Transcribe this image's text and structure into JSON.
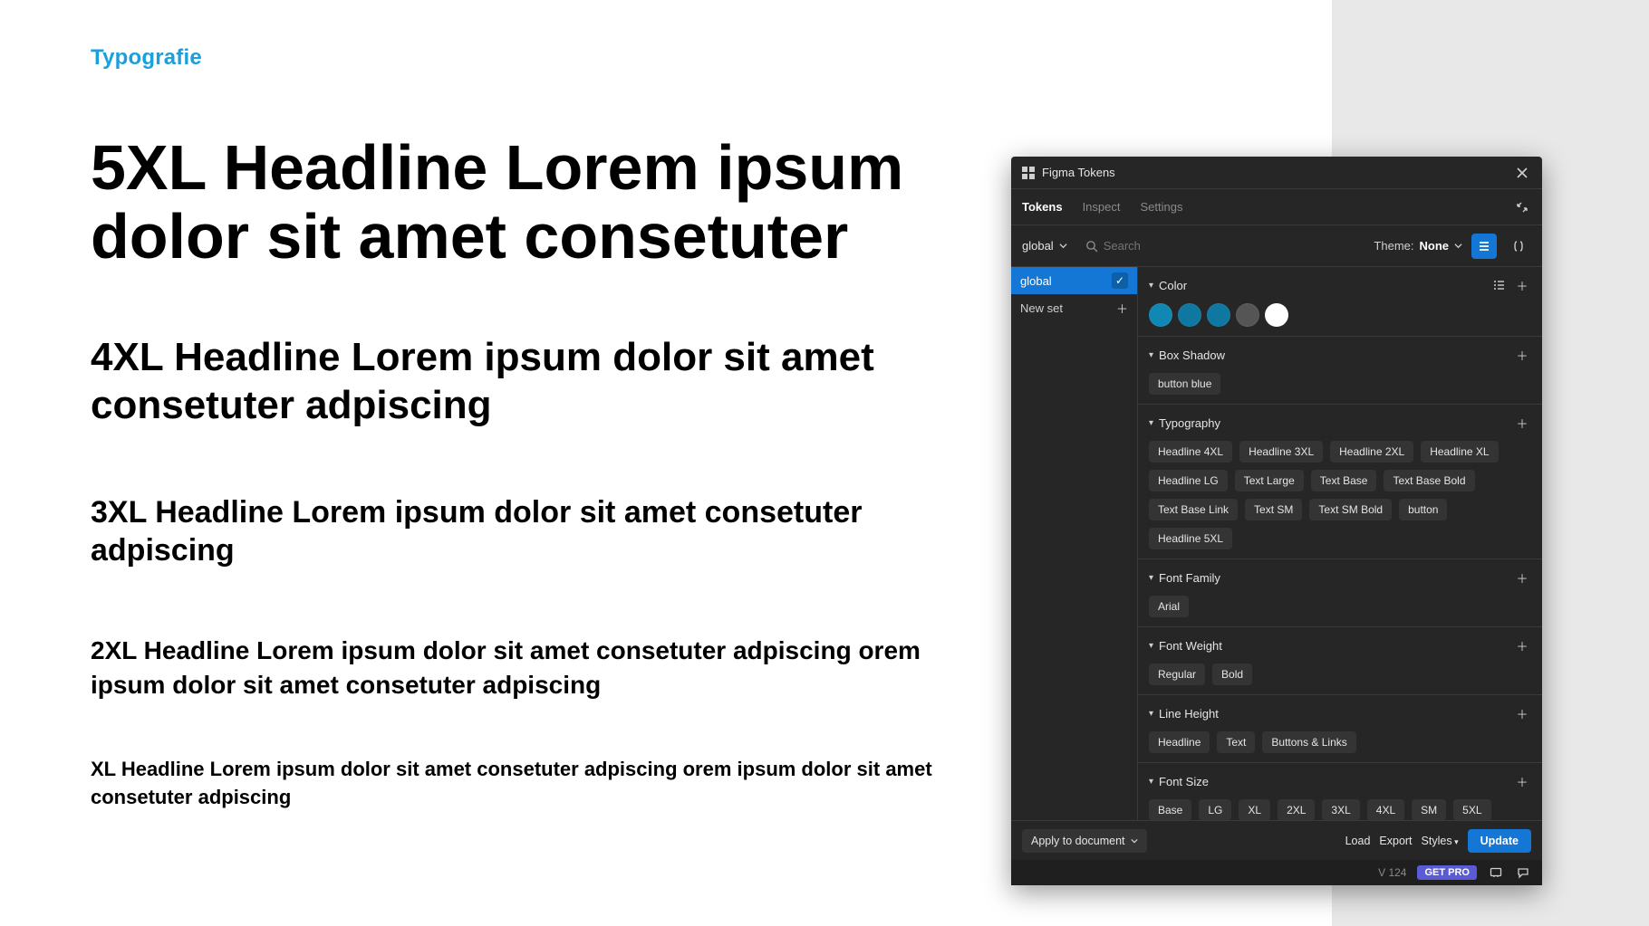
{
  "doc": {
    "section_title": "Typografie",
    "h5xl": "5XL Headline Lorem ipsum dolor sit amet consetuter",
    "h4xl": "4XL Headline Lorem ipsum dolor sit amet consetuter adpiscing",
    "h3xl": "3XL Headline Lorem ipsum dolor sit amet consetuter adpiscing",
    "h2xl": "2XL Headline Lorem ipsum dolor sit amet consetuter adpiscing orem ipsum dolor sit amet consetuter adpiscing",
    "hxl": "XL Headline Lorem ipsum dolor sit amet consetuter adpiscing orem ipsum dolor sit amet consetuter adpiscing"
  },
  "panel": {
    "title": "Figma Tokens",
    "tabs": {
      "tokens": "Tokens",
      "inspect": "Inspect",
      "settings": "Settings"
    },
    "toolbar": {
      "scope": "global",
      "search_placeholder": "Search",
      "theme_label": "Theme:",
      "theme_value": "None"
    },
    "sidebar": {
      "set_active": "global",
      "new_set": "New set"
    },
    "groups": {
      "color": {
        "title": "Color",
        "swatches": [
          "#1187B3",
          "#0E78A0",
          "#0E78A0",
          "#555555",
          "#FFFFFF"
        ]
      },
      "box_shadow": {
        "title": "Box Shadow",
        "items": [
          "button blue"
        ]
      },
      "typography": {
        "title": "Typography",
        "items": [
          "Headline 4XL",
          "Headline 3XL",
          "Headline 2XL",
          "Headline XL",
          "Headline LG",
          "Text Large",
          "Text Base",
          "Text Base Bold",
          "Text Base Link",
          "Text SM",
          "Text SM Bold",
          "button",
          "Headline 5XL"
        ]
      },
      "font_family": {
        "title": "Font Family",
        "items": [
          "Arial"
        ]
      },
      "font_weight": {
        "title": "Font Weight",
        "items": [
          "Regular",
          "Bold"
        ]
      },
      "line_height": {
        "title": "Line Height",
        "items": [
          "Headline",
          "Text",
          "Buttons & Links"
        ]
      },
      "font_size": {
        "title": "Font Size",
        "items": [
          "Base",
          "LG",
          "XL",
          "2XL",
          "3XL",
          "4XL",
          "SM",
          "5XL"
        ]
      }
    },
    "footer": {
      "apply": "Apply to document",
      "load": "Load",
      "export": "Export",
      "styles": "Styles",
      "update": "Update"
    },
    "status": {
      "version": "V 124",
      "pro": "GET PRO"
    }
  }
}
